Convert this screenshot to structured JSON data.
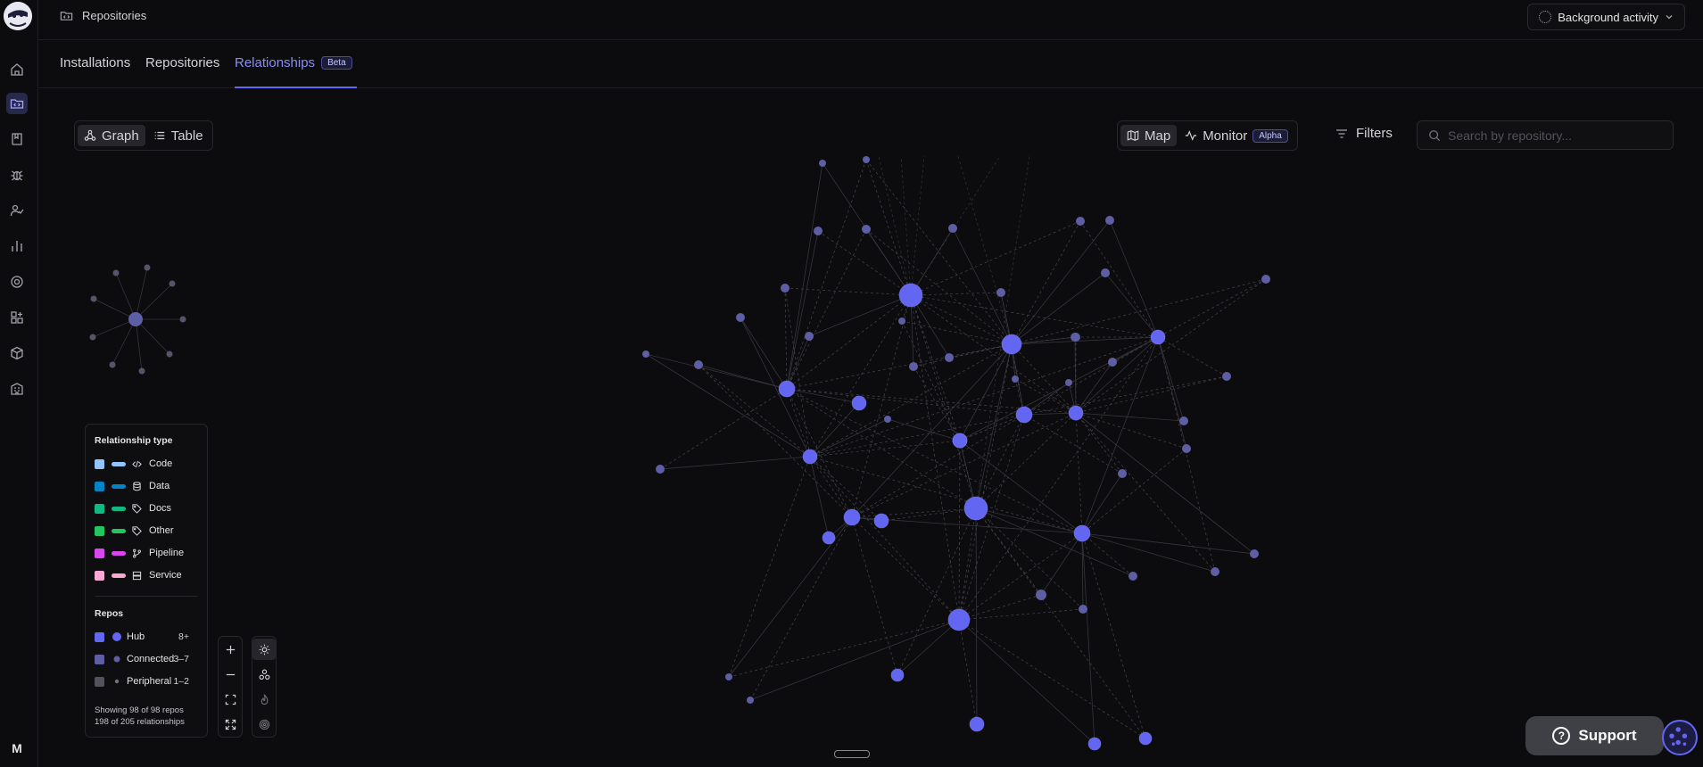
{
  "header": {
    "breadcrumb": "Repositories",
    "background_activity": "Background activity"
  },
  "tabs": [
    {
      "label": "Installations"
    },
    {
      "label": "Repositories"
    },
    {
      "label": "Relationships",
      "badge": "Beta"
    }
  ],
  "view_toggle": {
    "graph": "Graph",
    "table": "Table"
  },
  "mode_toggle": {
    "map": "Map",
    "monitor": "Monitor",
    "monitor_badge": "Alpha"
  },
  "filters_label": "Filters",
  "search": {
    "placeholder": "Search by repository..."
  },
  "legend": {
    "relationship_title": "Relationship type",
    "types": [
      {
        "label": "Code",
        "color": "#93c5fd",
        "icon": "code-icon"
      },
      {
        "label": "Data",
        "color": "#0ea5e9",
        "icon": "database-icon"
      },
      {
        "label": "Docs",
        "color": "#10b981",
        "icon": "tag-icon"
      },
      {
        "label": "Other",
        "color": "#22c55e",
        "icon": "tag-icon"
      },
      {
        "label": "Pipeline",
        "color": "#d946ef",
        "icon": "git-branch-icon"
      },
      {
        "label": "Service",
        "color": "#f9a8d4",
        "icon": "server-icon"
      }
    ],
    "repos_title": "Repos",
    "repos": [
      {
        "label": "Hub",
        "count": "8+",
        "color": "#6366f1"
      },
      {
        "label": "Connected",
        "count": "3–7",
        "color": "#5d5ea3"
      },
      {
        "label": "Peripheral",
        "count": "1–2",
        "color": "#52525b"
      }
    ],
    "footer_repos": "Showing 98 of 98 repos",
    "footer_rels": "198 of 205 relationships"
  },
  "support_label": "Support",
  "user_initial": "M",
  "colors": {
    "accent": "#6366f1",
    "node": "#6366f1",
    "node_small": "#5d5ea3"
  }
}
